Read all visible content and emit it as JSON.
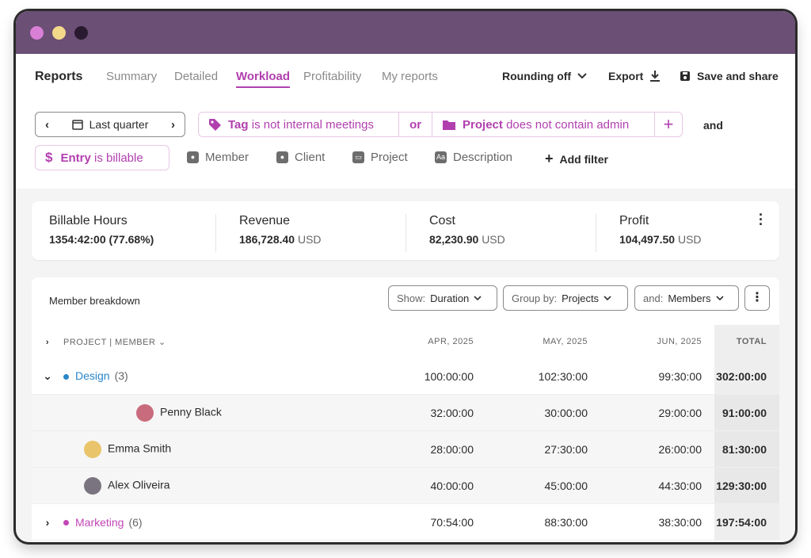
{
  "nav": {
    "title": "Reports",
    "tabs": [
      "Summary",
      "Detailed",
      "Workload",
      "Profitability",
      "My reports"
    ],
    "rounding": "Rounding off",
    "export": "Export",
    "save": "Save and share"
  },
  "filters": {
    "period": "Last quarter",
    "tag_prefix": "Tag",
    "tag_rest": "is not internal meetings",
    "or": "or",
    "project_prefix": "Project",
    "project_rest": "does not contain admin",
    "and": "and",
    "billable_prefix": "Entry",
    "billable_rest": "is billable",
    "buttons": [
      "Member",
      "Client",
      "Project",
      "Description"
    ],
    "add_filter": "Add filter"
  },
  "summary": {
    "billable": {
      "label": "Billable Hours",
      "value": "1354:42:00 (77.68%)"
    },
    "revenue": {
      "label": "Revenue",
      "value": "186,728.40",
      "currency": "USD"
    },
    "cost": {
      "label": "Cost",
      "value": "82,230.90",
      "currency": "USD"
    },
    "profit": {
      "label": "Profit",
      "value": "104,497.50",
      "currency": "USD"
    }
  },
  "breakdown": {
    "title": "Member breakdown",
    "show_label": "Show:",
    "show_value": "Duration",
    "group_label": "Group by:",
    "group_value": "Projects",
    "and_label": "and:",
    "and_value": "Members",
    "columns": [
      "PROJECT | MEMBER",
      "APR, 2025",
      "MAY, 2025",
      "JUN, 2025",
      "TOTAL"
    ],
    "rows": [
      {
        "name": "Design",
        "count": "(3)",
        "color": "#2a86c9",
        "values": [
          "100:00:00",
          "102:30:00",
          "99:30:00",
          "302:00:00"
        ]
      },
      {
        "name": "Penny Black",
        "values": [
          "32:00:00",
          "30:00:00",
          "29:00:00",
          "91:00:00"
        ]
      },
      {
        "name": "Emma Smith",
        "values": [
          "28:00:00",
          "27:30:00",
          "26:00:00",
          "81:30:00"
        ]
      },
      {
        "name": "Alex Oliveira",
        "values": [
          "40:00:00",
          "45:00:00",
          "44:30:00",
          "129:30:00"
        ]
      },
      {
        "name": "Marketing",
        "count": "(6)",
        "color": "#c147b8",
        "values": [
          "70:54:00",
          "88:30:00",
          "38:30:00",
          "197:54:00"
        ]
      }
    ]
  },
  "colors": {
    "accent": "#b13fae",
    "titlebar": "#6b4f75"
  }
}
